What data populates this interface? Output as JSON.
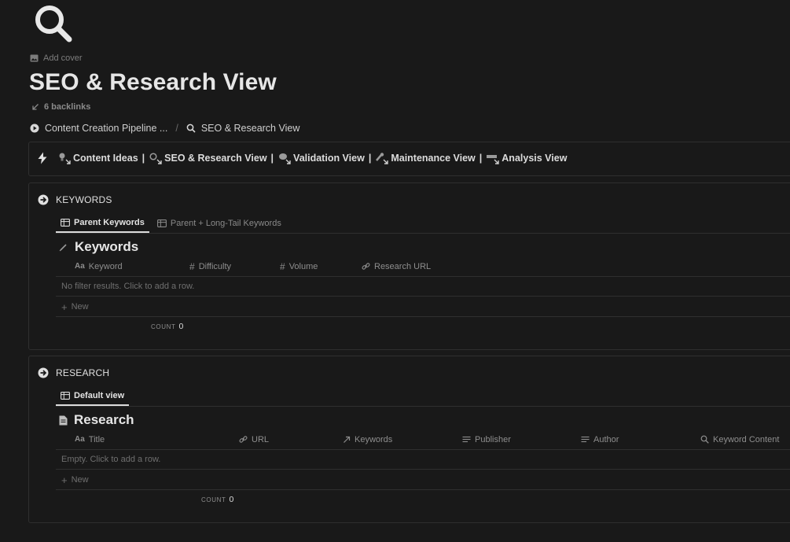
{
  "page": {
    "icon": "magnifying-glass-icon",
    "add_cover": "Add cover",
    "title": "SEO & Research View",
    "backlinks": "6 backlinks"
  },
  "breadcrumb": [
    {
      "label": "Content Creation Pipeline ...",
      "icon": "play-circle-icon"
    },
    {
      "label": "SEO & Research View",
      "icon": "search-icon"
    }
  ],
  "breadcrumb_sep": "/",
  "callout": {
    "icon": "lightning-icon",
    "links": [
      {
        "label": "Content Ideas",
        "icon": "lightbulb-link-icon"
      },
      {
        "label": "SEO & Research View",
        "icon": "search-link-icon"
      },
      {
        "label": "Validation View",
        "icon": "brain-link-icon"
      },
      {
        "label": "Maintenance View",
        "icon": "wrench-link-icon"
      },
      {
        "label": "Analysis View",
        "icon": "chart-link-icon"
      }
    ],
    "pipe": "|"
  },
  "keywords": {
    "heading": "KEYWORDS",
    "tabs": [
      {
        "label": "Parent Keywords",
        "active": true
      },
      {
        "label": "Parent + Long-Tail Keywords",
        "active": false
      }
    ],
    "db_title": "Keywords",
    "columns": [
      {
        "label": "Keyword",
        "icon": "Aa"
      },
      {
        "label": "Difficulty",
        "icon": "#"
      },
      {
        "label": "Volume",
        "icon": "#"
      },
      {
        "label": "Research URL",
        "icon": "link"
      }
    ],
    "empty_text": "No filter results. Click to add a row.",
    "new_label": "New",
    "count_label": "COUNT",
    "count_value": "0"
  },
  "research": {
    "heading": "RESEARCH",
    "tabs": [
      {
        "label": "Default view",
        "active": true
      }
    ],
    "db_title": "Research",
    "columns": [
      {
        "label": "Title",
        "icon": "Aa"
      },
      {
        "label": "URL",
        "icon": "link"
      },
      {
        "label": "Keywords",
        "icon": "relation-arrow"
      },
      {
        "label": "Publisher",
        "icon": "lines"
      },
      {
        "label": "Author",
        "icon": "lines"
      },
      {
        "label": "Keyword Content",
        "icon": "search"
      }
    ],
    "empty_text": "Empty. Click to add a row.",
    "new_label": "New",
    "count_label": "COUNT",
    "count_value": "0"
  },
  "colors": {
    "background": "#191919",
    "text": "#d4d4d4",
    "muted": "#7d7d7d",
    "border": "#2f2f2f"
  }
}
